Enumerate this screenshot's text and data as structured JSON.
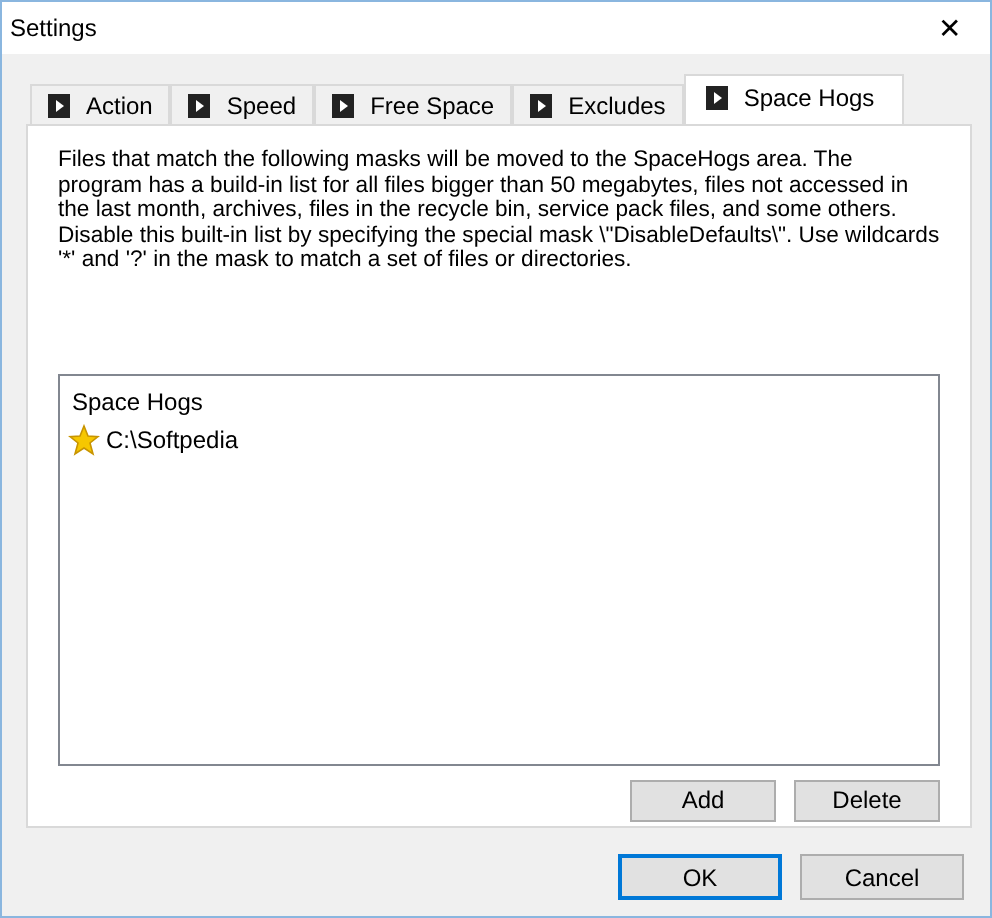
{
  "window": {
    "title": "Settings",
    "close": "✕"
  },
  "tabs": [
    {
      "label": "Action",
      "selected": false
    },
    {
      "label": "Speed",
      "selected": false
    },
    {
      "label": "Free Space",
      "selected": false
    },
    {
      "label": "Excludes",
      "selected": false
    },
    {
      "label": "Space Hogs",
      "selected": true
    }
  ],
  "description": "Files that match the following masks will be moved to the SpaceHogs area. The program has a build-in list for all files bigger than 50 megabytes, files not accessed in the last month, archives, files in the recycle bin, service pack files, and some others. Disable this built-in list by specifying the special mask \\\"DisableDefaults\\\". Use wildcards '*' and '?' in the mask to match a set of files or directories.",
  "list": {
    "header": "Space Hogs",
    "items": [
      {
        "label": "C:\\Softpedia"
      }
    ]
  },
  "list_buttons": [
    "Add",
    "Delete"
  ],
  "dialog_buttons": [
    {
      "label": "OK",
      "default": true
    },
    {
      "label": "Cancel",
      "default": false
    }
  ]
}
